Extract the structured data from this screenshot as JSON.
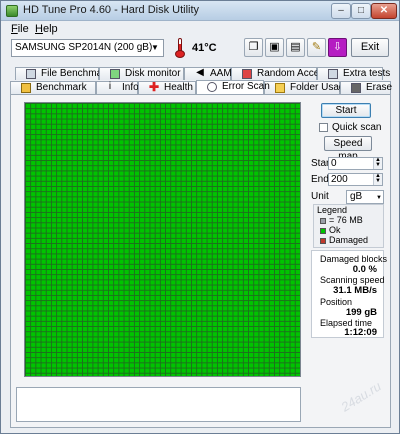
{
  "window": {
    "title": "HD Tune Pro 4.60 - Hard Disk Utility",
    "min": "–",
    "max": "□",
    "close": "✕"
  },
  "menu": {
    "file": "File",
    "help": "Help"
  },
  "toolbar": {
    "drive": "SAMSUNG SP2014N (200 gB)",
    "temperature": "41°C",
    "exit_label": "Exit",
    "icons": [
      "copy-info-icon",
      "copy-screen-icon",
      "save-icon",
      "options-icon",
      "download-icon"
    ],
    "accent_purple": "#b51cc2"
  },
  "tabs_top": [
    {
      "label": "File Benchmark",
      "icon": "file-benchmark-icon"
    },
    {
      "label": "Disk monitor",
      "icon": "disk-monitor-icon"
    },
    {
      "label": "AAM",
      "icon": "speaker-icon"
    },
    {
      "label": "Random Access",
      "icon": "random-access-icon"
    },
    {
      "label": "Extra tests",
      "icon": "extra-tests-icon"
    }
  ],
  "tabs_bottom": [
    {
      "label": "Benchmark",
      "icon": "benchmark-icon"
    },
    {
      "label": "Info",
      "icon": "info-icon"
    },
    {
      "label": "Health",
      "icon": "health-icon"
    },
    {
      "label": "Error Scan",
      "icon": "error-scan-icon",
      "active": true
    },
    {
      "label": "Folder Usage",
      "icon": "folder-icon"
    },
    {
      "label": "Erase",
      "icon": "erase-icon"
    }
  ],
  "scan": {
    "status": "all-ok",
    "ok_color": "#00c400",
    "damaged_color": "#c0392b"
  },
  "controls": {
    "start_label": "Start",
    "quick_scan_label": "Quick scan",
    "quick_scan_checked": false,
    "speed_map_label": "Speed map",
    "start_field_label": "Start",
    "start_value": "0",
    "end_field_label": "End",
    "end_value": "200",
    "unit_label": "Unit",
    "unit_value": "gB"
  },
  "legend": {
    "title": "Legend",
    "block_size": "= 76 MB",
    "ok": "Ok",
    "damaged": "Damaged"
  },
  "stats": {
    "damaged_blocks_label": "Damaged blocks",
    "damaged_blocks_value": "0.0 %",
    "scanning_speed_label": "Scanning speed",
    "scanning_speed_value": "31.1 MB/s",
    "position_label": "Position",
    "position_value": "199 gB",
    "elapsed_label": "Elapsed time",
    "elapsed_value": "1:12:09"
  }
}
